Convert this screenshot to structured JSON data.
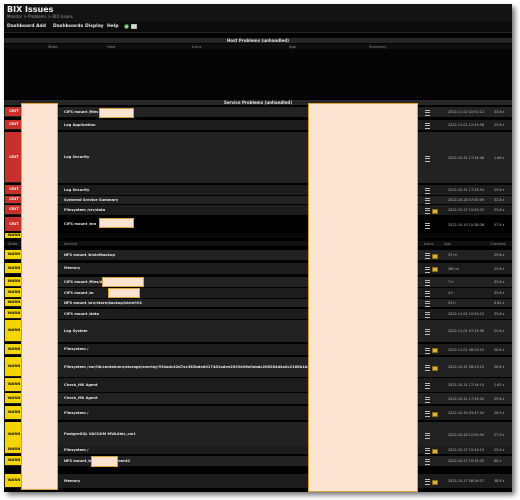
{
  "page": {
    "title": "BIX Issues",
    "breadcrumb": "Monitor > Problems > BIX Issues"
  },
  "menu": [
    "Dashboard",
    "Add",
    "Dashboards",
    "Display",
    "Help"
  ],
  "host_problems": {
    "title": "Host Problems (unhandled)",
    "columns": [
      "State",
      "Host",
      "Icons",
      "Age",
      "Summary"
    ]
  },
  "service_problems": {
    "title": "Service Problems (unhandled)",
    "columns": [
      "State",
      "Service",
      "Icons",
      "Age",
      "Checked"
    ],
    "rows": [
      {
        "state": "CRIT",
        "service": "CIFS mount /files",
        "age": "2022-11-02 10:51:12",
        "checked": "33.6 s",
        "selected": false,
        "icons": [
          "menu"
        ]
      },
      {
        "state": "CRIT",
        "service": "Log Application",
        "age": "2022-11-01 12:43:58",
        "checked": "25.6 s",
        "selected": false,
        "icons": [
          "menu"
        ]
      },
      {
        "state": "CRIT",
        "service": "Log Security",
        "age": "2022-10-31 17:34:46",
        "checked": "1.86 s",
        "selected": false,
        "icons": [
          "menu"
        ]
      },
      {
        "state": "CRIT",
        "service": "Log Security",
        "age": "2022-10-31 17:33:54",
        "checked": "25.6 s",
        "selected": false,
        "icons": [
          "menu"
        ]
      },
      {
        "state": "CRIT",
        "service": "Systemd Service Summary",
        "age": "2022-10-28 07:30:59",
        "checked": "32.8 s",
        "selected": false,
        "icons": [
          "menu"
        ]
      },
      {
        "state": "CRIT",
        "service": "Filesystem /srv/data",
        "age": "2022-10-27 15:53:25",
        "checked": "53.6 s",
        "selected": false,
        "icons": [
          "menu",
          "graph"
        ]
      },
      {
        "state": "CRIT",
        "service": "CIFS mount /mn",
        "age": "2022-10-10 10:38:38",
        "checked": "57.6 s",
        "selected": true,
        "icons": [
          "menu"
        ]
      },
      {
        "state": "WARN",
        "service": "",
        "age": "",
        "checked": "",
        "selected": false,
        "icons": [],
        "partial": true
      },
      {
        "state": "WARN",
        "service": "NFS mount /bixinfbackup",
        "age": "37 m",
        "checked": "25.6 s",
        "selected": false,
        "icons": [
          "menu",
          "graph"
        ]
      },
      {
        "state": "WARN",
        "service": "Memory",
        "age": "380 m",
        "checked": "25.6 s",
        "selected": false,
        "icons": [
          "menu",
          "graph"
        ]
      },
      {
        "state": "WARN",
        "service": "CIFS mount /files/d",
        "age": "7 h",
        "checked": "33.6 s",
        "selected": false,
        "icons": [
          "menu"
        ]
      },
      {
        "state": "WARN",
        "service": "CIFS mount /m",
        "age": "4 h",
        "checked": "33.6 s",
        "selected": false,
        "icons": [
          "menu"
        ]
      },
      {
        "state": "WARN",
        "service": "NFS mount /srv/store/backup/bixinf/01",
        "age": "25 h",
        "checked": "4.81 s",
        "selected": false,
        "icons": [
          "menu"
        ]
      },
      {
        "state": "WARN",
        "service": "CIFS mount /data",
        "age": "2022-11-02 10:53:12",
        "checked": "33.6 s",
        "selected": false,
        "icons": [
          "menu"
        ]
      },
      {
        "state": "WARN",
        "service": "Log System",
        "age": "2022-11-01 07:33:56",
        "checked": "25.6 s",
        "selected": false,
        "icons": [
          "menu"
        ]
      },
      {
        "state": "WARN",
        "service": "Filesystem /",
        "age": "2022-11-01 08:23:15",
        "checked": "58.8 s",
        "selected": false,
        "icons": [
          "menu",
          "graph"
        ]
      },
      {
        "state": "WARN",
        "service": "Filesystem /var/lib/containers/storage/overlay/934adc42d7ac383bded017481adee2092b06e0abdc206284d4a0c2168b1b589a/merged",
        "age": "2022-10-31 08:23:15",
        "checked": "58.8 s",
        "selected": false,
        "icons": [
          "menu",
          "graph"
        ]
      },
      {
        "state": "WARN",
        "service": "Check_MK Agent",
        "age": "2022-10-31 17:34:14",
        "checked": "2.62 s",
        "selected": false,
        "icons": [
          "menu"
        ]
      },
      {
        "state": "WARN",
        "service": "Check_MK Agent",
        "age": "2022-10-31 17:33:54",
        "checked": "25.6 s",
        "selected": false,
        "icons": [
          "menu"
        ]
      },
      {
        "state": "WARN",
        "service": "Filesystem /",
        "age": "2022-10-30 03:47:54",
        "checked": "28.9 s",
        "selected": false,
        "icons": [
          "menu",
          "graph"
        ]
      },
      {
        "state": "WARN",
        "service": "PostgreSQL VACUUM MVA#bix_cm1",
        "age": "2022-10-28 12:50:50",
        "checked": "57.9 s",
        "selected": false,
        "icons": [
          "menu"
        ]
      },
      {
        "state": "WARN",
        "service": "Filesystem /",
        "age": "2022-10-27 15:43:19",
        "checked": "23.0 s",
        "selected": false,
        "icons": [
          "menu",
          "graph"
        ]
      },
      {
        "state": "WARN",
        "service": "NFS mount /m",
        "age": "2022-10-27 15:32:35",
        "checked": "60 s",
        "selected": false,
        "icons": [
          "menu"
        ],
        "suffix": "ment2"
      },
      {
        "state": "WARN",
        "service": "Memory",
        "age": "2022-10-27 08:26:37",
        "checked": "38.8 s",
        "selected": false,
        "icons": [
          "menu",
          "graph"
        ]
      }
    ]
  }
}
